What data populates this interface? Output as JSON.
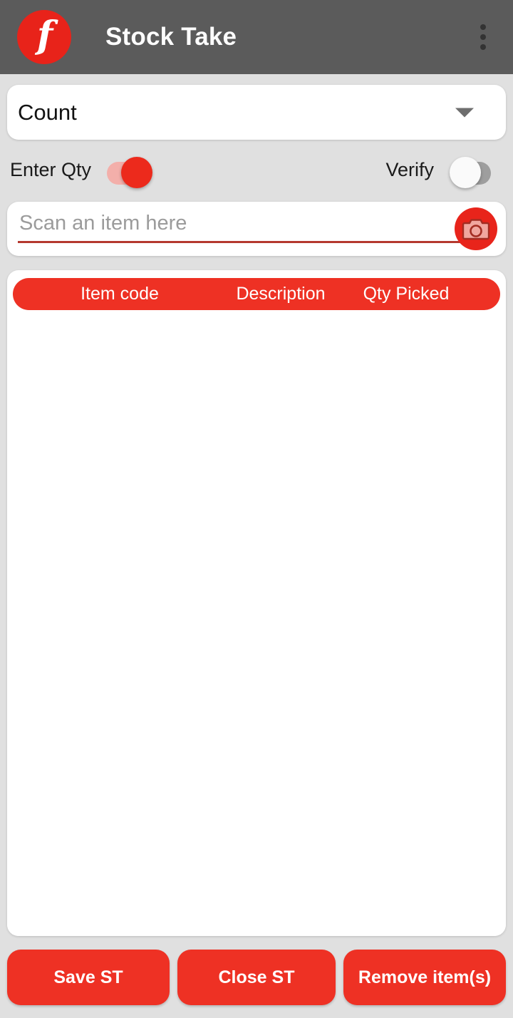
{
  "appbar": {
    "logo_glyph": "f",
    "logo_icon": "app-logo-icon",
    "title": "Stock Take",
    "overflow_icon": "overflow-menu-icon"
  },
  "mode_selector": {
    "selected": "Count",
    "options": [
      "Count"
    ],
    "caret_icon": "chevron-down-icon"
  },
  "toggles": {
    "enter_qty": {
      "label": "Enter Qty",
      "state": "on"
    },
    "verify": {
      "label": "Verify",
      "state": "off"
    }
  },
  "scan": {
    "value": "",
    "placeholder": "Scan an item here",
    "camera_icon": "camera-icon"
  },
  "list": {
    "columns": [
      "Item code",
      "Description",
      "Qty Picked"
    ],
    "rows": []
  },
  "actions": {
    "save": "Save ST",
    "close": "Close ST",
    "remove": "Remove item(s)"
  },
  "colors": {
    "brand_red": "#ee3124",
    "logo_red": "#e8231a",
    "appbar_gray": "#5b5b5b",
    "page_bg": "#e0e0e0",
    "underline_red": "#b5392f",
    "toggle_on_track": "#f3afaa",
    "toggle_off_track": "#9e9e9e"
  }
}
